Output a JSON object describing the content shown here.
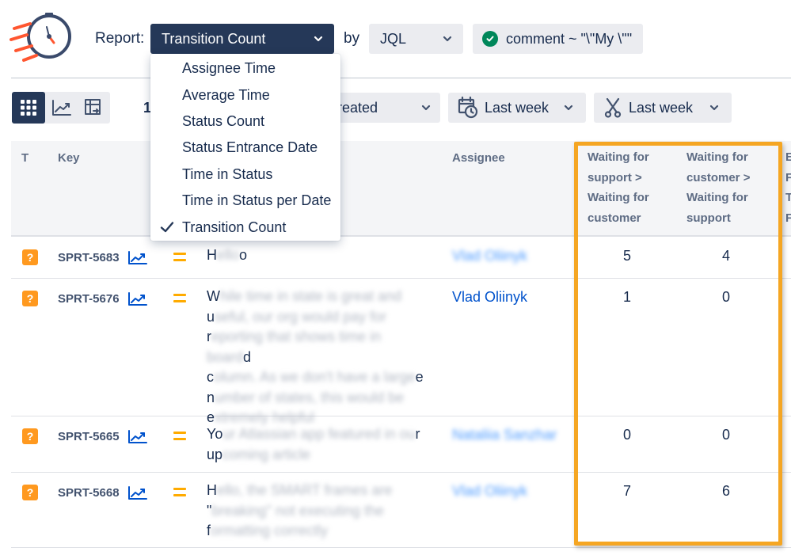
{
  "header": {
    "report_label": "Report:",
    "report_selected": "Transition Count",
    "by_label": "by",
    "source_selected": "JQL",
    "filter_text": "comment ~ \"\\\"My \\\"\""
  },
  "report_menu": {
    "items": [
      {
        "label": "Assignee Time",
        "selected": false
      },
      {
        "label": "Average Time",
        "selected": false
      },
      {
        "label": "Status Count",
        "selected": false
      },
      {
        "label": "Status Entrance Date",
        "selected": false
      },
      {
        "label": "Time in Status",
        "selected": false
      },
      {
        "label": "Time in Status per Date",
        "selected": false
      },
      {
        "label": "Transition Count",
        "selected": true
      }
    ]
  },
  "toolbar": {
    "count_text": "1",
    "date_field": "reated",
    "created_range": "Last week",
    "resolved_range": "Last week"
  },
  "table": {
    "headers": {
      "type": "T",
      "key": "Key",
      "assignee": "Assignee",
      "col1_lines": [
        "Waiting for",
        "support >",
        "Waiting for",
        "customer"
      ],
      "col2_lines": [
        "Waiting for",
        "customer >",
        "Waiting for",
        "support"
      ],
      "col3_lines": [
        "E",
        "F",
        "T",
        "F"
      ]
    },
    "rows": [
      {
        "type_icon": "?",
        "key": "SPRT-5683",
        "summary_lines": [
          [
            "H",
            "ello",
            "o"
          ]
        ],
        "assignee": "Vlad Oliinyk",
        "assignee_blurred": true,
        "col1": "5",
        "col2": "4"
      },
      {
        "type_icon": "?",
        "key": "SPRT-5676",
        "summary_lines": [
          [
            "W",
            "hile time in state is great and",
            ""
          ],
          [
            "u",
            "seful, our org would pay for",
            ""
          ],
          [
            "r",
            "eporting that shows time in board",
            "d"
          ],
          [
            "c",
            "olumn. As we don't have a large",
            "e"
          ],
          [
            "n",
            "umber of states, this would be",
            ""
          ],
          [
            "e",
            "xtremely helpful",
            ""
          ]
        ],
        "assignee": "Vlad Oliinyk",
        "assignee_blurred": false,
        "col1": "1",
        "col2": "0"
      },
      {
        "type_icon": "?",
        "key": "SPRT-5665",
        "summary_lines": [
          [
            "Yo",
            "ur Atlassian app featured in ou",
            "r"
          ],
          [
            "up",
            "coming article",
            ""
          ]
        ],
        "assignee": "Nataliia Sanzhar",
        "assignee_blurred": true,
        "col1": "0",
        "col2": "0"
      },
      {
        "type_icon": "?",
        "key": "SPRT-5668",
        "summary_lines": [
          [
            "H",
            "ello, the SMART frames are",
            ""
          ],
          [
            "\"",
            "breaking\" not executing the",
            ""
          ],
          [
            "f",
            "ormatting correctly",
            ""
          ]
        ],
        "assignee": "Vlad Oliinyk",
        "assignee_blurred": true,
        "col1": "7",
        "col2": "6"
      }
    ]
  },
  "icons": {
    "logo": "stopwatch-logo-icon",
    "dropdown": "chevron-down-icon",
    "filter_valid": "check-circle-icon",
    "grid_view": "grid-icon",
    "chart_view": "line-chart-icon",
    "pivot_view": "pivot-table-icon",
    "calendar": "calendar-clock-icon",
    "resolved": "scissors-icon",
    "issue_trend": "trend-icon",
    "priority": "priority-medium-icon"
  },
  "colors": {
    "accent_dark": "#253858",
    "highlight": "#f5a623",
    "link": "#0052cc",
    "issue_type": "#ff991f",
    "priority": "#ffab00",
    "valid": "#00875a"
  }
}
